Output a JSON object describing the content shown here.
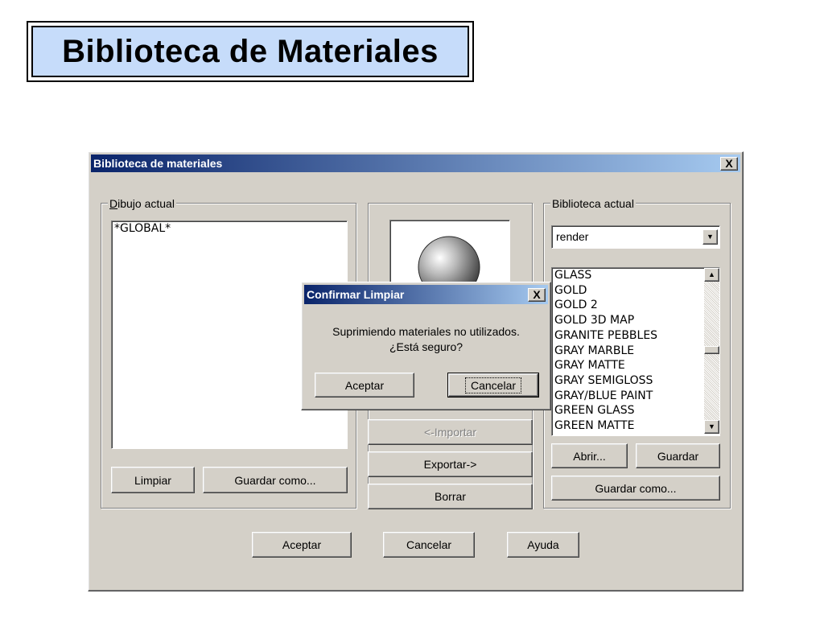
{
  "slide": {
    "title": "Biblioteca de Materiales"
  },
  "main_window": {
    "title": "Biblioteca de materiales",
    "close_label": "X",
    "current_drawing": {
      "group_label": "Dibujo actual",
      "items": [
        "*GLOBAL*"
      ],
      "clear_button": "Limpiar",
      "save_as_button": "Guardar como..."
    },
    "preview": {
      "import_button": "<-Importar",
      "export_button": "Exportar->",
      "delete_button": "Borrar"
    },
    "current_library": {
      "group_label": "Biblioteca actual",
      "dropdown_value": "render",
      "items": [
        "GLASS",
        "GOLD",
        "GOLD 2",
        "GOLD 3D MAP",
        "GRANITE PEBBLES",
        "GRAY MARBLE",
        "GRAY MATTE",
        "GRAY SEMIGLOSS",
        "GRAY/BLUE PAINT",
        "GREEN GLASS",
        "GREEN MATTE"
      ],
      "open_button": "Abrir...",
      "save_button": "Guardar",
      "save_as_button": "Guardar como..."
    },
    "footer": {
      "ok_button": "Aceptar",
      "cancel_button": "Cancelar",
      "help_button": "Ayuda"
    }
  },
  "confirm_dialog": {
    "title": "Confirmar Limpiar",
    "close_label": "X",
    "message_line1": "Suprimiendo materiales no utilizados.",
    "message_line2": "¿Está seguro?",
    "ok_button": "Aceptar",
    "cancel_button": "Cancelar"
  }
}
